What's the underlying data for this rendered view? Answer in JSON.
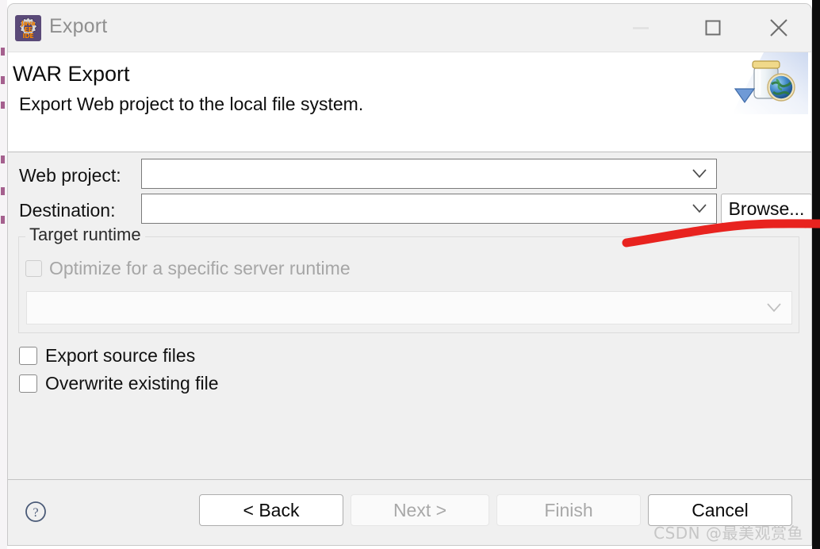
{
  "window": {
    "title": "Export",
    "icon_name": "java-ee-ide-icon",
    "icon_badge_line1": "Java EE",
    "icon_badge_line2": "IDE",
    "controls": {
      "minimize": "–",
      "maximize": "□",
      "close": "✕"
    }
  },
  "header": {
    "title": "WAR Export",
    "description": "Export Web project to the local file system.",
    "banner_icon_name": "war-export-jar-globe-icon"
  },
  "form": {
    "web_project": {
      "label": "Web project:",
      "value": "",
      "placeholder": ""
    },
    "destination": {
      "label": "Destination:",
      "value": "",
      "placeholder": ""
    },
    "browse_label": "Browse...",
    "target_runtime": {
      "legend": "Target runtime",
      "optimize_label": "Optimize for a specific server runtime",
      "optimize_checked": false,
      "optimize_enabled": false,
      "runtime_value": "",
      "runtime_enabled": false
    },
    "options": [
      {
        "label": "Export source files",
        "checked": false
      },
      {
        "label": "Overwrite existing file",
        "checked": false
      }
    ]
  },
  "footer": {
    "help_icon_name": "help-icon",
    "buttons": [
      {
        "name": "back",
        "label": "< Back",
        "enabled": true
      },
      {
        "name": "next",
        "label": "Next >",
        "enabled": false
      },
      {
        "name": "finish",
        "label": "Finish",
        "enabled": false
      },
      {
        "name": "cancel",
        "label": "Cancel",
        "enabled": true
      }
    ]
  },
  "watermark": "CSDN @最美观赏鱼",
  "annotation": {
    "name": "red-underline-annotation",
    "color": "#e8231f"
  },
  "colors": {
    "dialog_bg": "#f0f0f0",
    "header_bg": "#ffffff",
    "titlebar_bg": "#f1f1f1",
    "accent_red": "#e8231f",
    "icon_purple": "#5a4a78"
  }
}
